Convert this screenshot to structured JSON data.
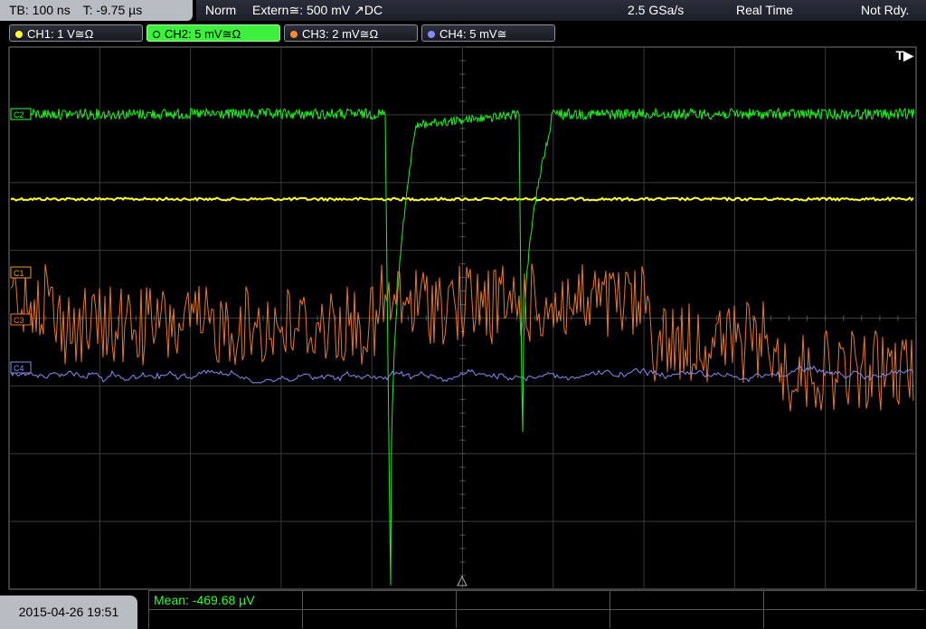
{
  "topbar": {
    "timebase": "TB: 100 ns",
    "trigger_time": "T: -9.75 µs",
    "mode": "Norm",
    "trigger_source": "Extern≅: 500 mV ↗DC",
    "sample_rate": "2.5 GSa/s",
    "acq_mode": "Real Time",
    "status": "Not Rdy."
  },
  "channels": [
    {
      "label": "CH1: 1 V≅Ω",
      "color": "#ffff33"
    },
    {
      "label": "CH2: 5 mV≅Ω",
      "color": "#33ff33"
    },
    {
      "label": "CH3: 2 mV≅Ω",
      "color": "#ff8833"
    },
    {
      "label": "CH4: 5 mV≅",
      "color": "#8888ff"
    }
  ],
  "markers": {
    "c2": "C2",
    "c1": "C1",
    "c3": "C3",
    "c4": "C4",
    "trigger": "T▶"
  },
  "bottombar": {
    "datetime": "2015-04-26 19:51",
    "measurement": "Mean: -469.68 µV"
  }
}
